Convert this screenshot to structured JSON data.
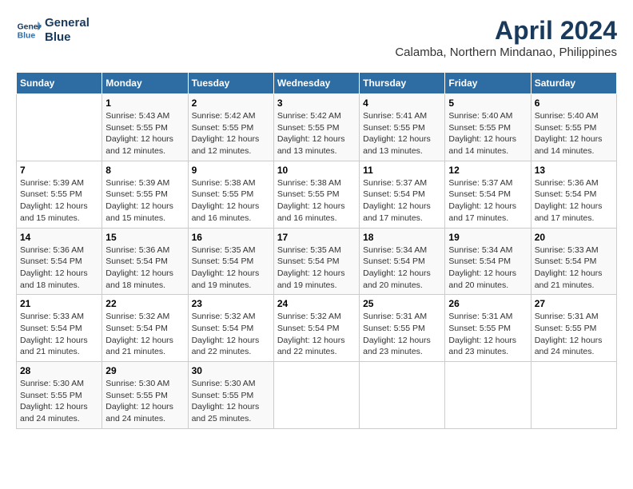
{
  "header": {
    "logo_line1": "General",
    "logo_line2": "Blue",
    "title": "April 2024",
    "subtitle": "Calamba, Northern Mindanao, Philippines"
  },
  "days_of_week": [
    "Sunday",
    "Monday",
    "Tuesday",
    "Wednesday",
    "Thursday",
    "Friday",
    "Saturday"
  ],
  "weeks": [
    [
      {
        "day": "",
        "info": ""
      },
      {
        "day": "1",
        "info": "Sunrise: 5:43 AM\nSunset: 5:55 PM\nDaylight: 12 hours\nand 12 minutes."
      },
      {
        "day": "2",
        "info": "Sunrise: 5:42 AM\nSunset: 5:55 PM\nDaylight: 12 hours\nand 12 minutes."
      },
      {
        "day": "3",
        "info": "Sunrise: 5:42 AM\nSunset: 5:55 PM\nDaylight: 12 hours\nand 13 minutes."
      },
      {
        "day": "4",
        "info": "Sunrise: 5:41 AM\nSunset: 5:55 PM\nDaylight: 12 hours\nand 13 minutes."
      },
      {
        "day": "5",
        "info": "Sunrise: 5:40 AM\nSunset: 5:55 PM\nDaylight: 12 hours\nand 14 minutes."
      },
      {
        "day": "6",
        "info": "Sunrise: 5:40 AM\nSunset: 5:55 PM\nDaylight: 12 hours\nand 14 minutes."
      }
    ],
    [
      {
        "day": "7",
        "info": "Sunrise: 5:39 AM\nSunset: 5:55 PM\nDaylight: 12 hours\nand 15 minutes."
      },
      {
        "day": "8",
        "info": "Sunrise: 5:39 AM\nSunset: 5:55 PM\nDaylight: 12 hours\nand 15 minutes."
      },
      {
        "day": "9",
        "info": "Sunrise: 5:38 AM\nSunset: 5:55 PM\nDaylight: 12 hours\nand 16 minutes."
      },
      {
        "day": "10",
        "info": "Sunrise: 5:38 AM\nSunset: 5:55 PM\nDaylight: 12 hours\nand 16 minutes."
      },
      {
        "day": "11",
        "info": "Sunrise: 5:37 AM\nSunset: 5:54 PM\nDaylight: 12 hours\nand 17 minutes."
      },
      {
        "day": "12",
        "info": "Sunrise: 5:37 AM\nSunset: 5:54 PM\nDaylight: 12 hours\nand 17 minutes."
      },
      {
        "day": "13",
        "info": "Sunrise: 5:36 AM\nSunset: 5:54 PM\nDaylight: 12 hours\nand 17 minutes."
      }
    ],
    [
      {
        "day": "14",
        "info": "Sunrise: 5:36 AM\nSunset: 5:54 PM\nDaylight: 12 hours\nand 18 minutes."
      },
      {
        "day": "15",
        "info": "Sunrise: 5:36 AM\nSunset: 5:54 PM\nDaylight: 12 hours\nand 18 minutes."
      },
      {
        "day": "16",
        "info": "Sunrise: 5:35 AM\nSunset: 5:54 PM\nDaylight: 12 hours\nand 19 minutes."
      },
      {
        "day": "17",
        "info": "Sunrise: 5:35 AM\nSunset: 5:54 PM\nDaylight: 12 hours\nand 19 minutes."
      },
      {
        "day": "18",
        "info": "Sunrise: 5:34 AM\nSunset: 5:54 PM\nDaylight: 12 hours\nand 20 minutes."
      },
      {
        "day": "19",
        "info": "Sunrise: 5:34 AM\nSunset: 5:54 PM\nDaylight: 12 hours\nand 20 minutes."
      },
      {
        "day": "20",
        "info": "Sunrise: 5:33 AM\nSunset: 5:54 PM\nDaylight: 12 hours\nand 21 minutes."
      }
    ],
    [
      {
        "day": "21",
        "info": "Sunrise: 5:33 AM\nSunset: 5:54 PM\nDaylight: 12 hours\nand 21 minutes."
      },
      {
        "day": "22",
        "info": "Sunrise: 5:32 AM\nSunset: 5:54 PM\nDaylight: 12 hours\nand 21 minutes."
      },
      {
        "day": "23",
        "info": "Sunrise: 5:32 AM\nSunset: 5:54 PM\nDaylight: 12 hours\nand 22 minutes."
      },
      {
        "day": "24",
        "info": "Sunrise: 5:32 AM\nSunset: 5:54 PM\nDaylight: 12 hours\nand 22 minutes."
      },
      {
        "day": "25",
        "info": "Sunrise: 5:31 AM\nSunset: 5:55 PM\nDaylight: 12 hours\nand 23 minutes."
      },
      {
        "day": "26",
        "info": "Sunrise: 5:31 AM\nSunset: 5:55 PM\nDaylight: 12 hours\nand 23 minutes."
      },
      {
        "day": "27",
        "info": "Sunrise: 5:31 AM\nSunset: 5:55 PM\nDaylight: 12 hours\nand 24 minutes."
      }
    ],
    [
      {
        "day": "28",
        "info": "Sunrise: 5:30 AM\nSunset: 5:55 PM\nDaylight: 12 hours\nand 24 minutes."
      },
      {
        "day": "29",
        "info": "Sunrise: 5:30 AM\nSunset: 5:55 PM\nDaylight: 12 hours\nand 24 minutes."
      },
      {
        "day": "30",
        "info": "Sunrise: 5:30 AM\nSunset: 5:55 PM\nDaylight: 12 hours\nand 25 minutes."
      },
      {
        "day": "",
        "info": ""
      },
      {
        "day": "",
        "info": ""
      },
      {
        "day": "",
        "info": ""
      },
      {
        "day": "",
        "info": ""
      }
    ]
  ]
}
